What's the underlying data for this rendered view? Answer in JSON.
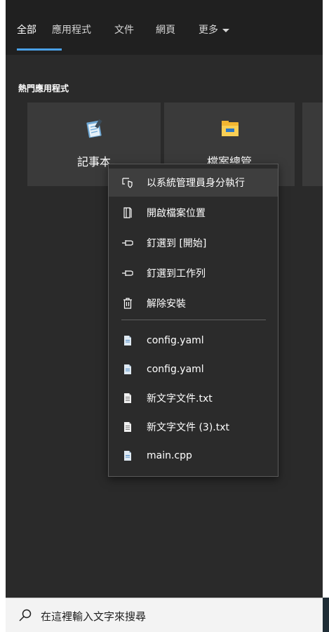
{
  "tabs": [
    {
      "label": "全部",
      "active": true
    },
    {
      "label": "應用程式"
    },
    {
      "label": "文件"
    },
    {
      "label": "網頁"
    },
    {
      "label": "更多"
    }
  ],
  "section_title": "熱門應用程式",
  "apps": [
    {
      "label": "記事本",
      "icon": "notepad-icon"
    },
    {
      "label": "檔案總管",
      "icon": "folder-icon"
    }
  ],
  "context_menu": {
    "actions": [
      {
        "label": "以系統管理員身分執行",
        "icon": "run-as-admin-icon"
      },
      {
        "label": "開啟檔案位置",
        "icon": "open-file-location-icon"
      },
      {
        "label": "釘選到 [開始]",
        "icon": "pin-icon"
      },
      {
        "label": "釘選到工作列",
        "icon": "pin-icon"
      },
      {
        "label": "解除安裝",
        "icon": "trash-icon"
      }
    ],
    "recent_files": [
      {
        "label": "config.yaml",
        "icon": "document-icon"
      },
      {
        "label": "config.yaml",
        "icon": "document-icon"
      },
      {
        "label": "新文字文件.txt",
        "icon": "text-file-icon"
      },
      {
        "label": "新文字文件 (3).txt",
        "icon": "text-file-icon"
      },
      {
        "label": "main.cpp",
        "icon": "document-icon"
      }
    ]
  },
  "search": {
    "placeholder": "在這裡輸入文字來搜尋"
  },
  "colors": {
    "accent": "#4aa0e6",
    "panel": "#2a2a2a",
    "tile": "#3a3a3a",
    "menu": "#2b2b2b"
  }
}
